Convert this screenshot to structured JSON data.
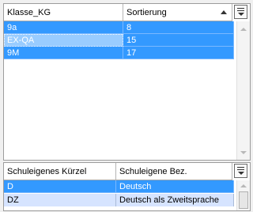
{
  "upper_grid": {
    "columns": [
      "Klasse_KG",
      "Sortierung"
    ],
    "rows": [
      {
        "klasse": "9a",
        "sort": "8"
      },
      {
        "klasse": "EX-QA",
        "sort": "15"
      },
      {
        "klasse": "9M",
        "sort": "17"
      }
    ],
    "sort_indicator": "ascending"
  },
  "lower_grid": {
    "columns": [
      "Schuleigenes Kürzel",
      "Schuleigene Bez."
    ],
    "rows": [
      {
        "kuerzel": "D",
        "bez": "Deutsch"
      },
      {
        "kuerzel": "DZ",
        "bez": "Deutsch als Zweitsprache"
      }
    ]
  },
  "colors": {
    "selection": "#3399ff",
    "current_cell": "#99ccff",
    "alt_row": "#d6e4ff"
  },
  "icons": {
    "column_chooser": "column-chooser-icon",
    "sort": "sort-ascending-icon"
  }
}
